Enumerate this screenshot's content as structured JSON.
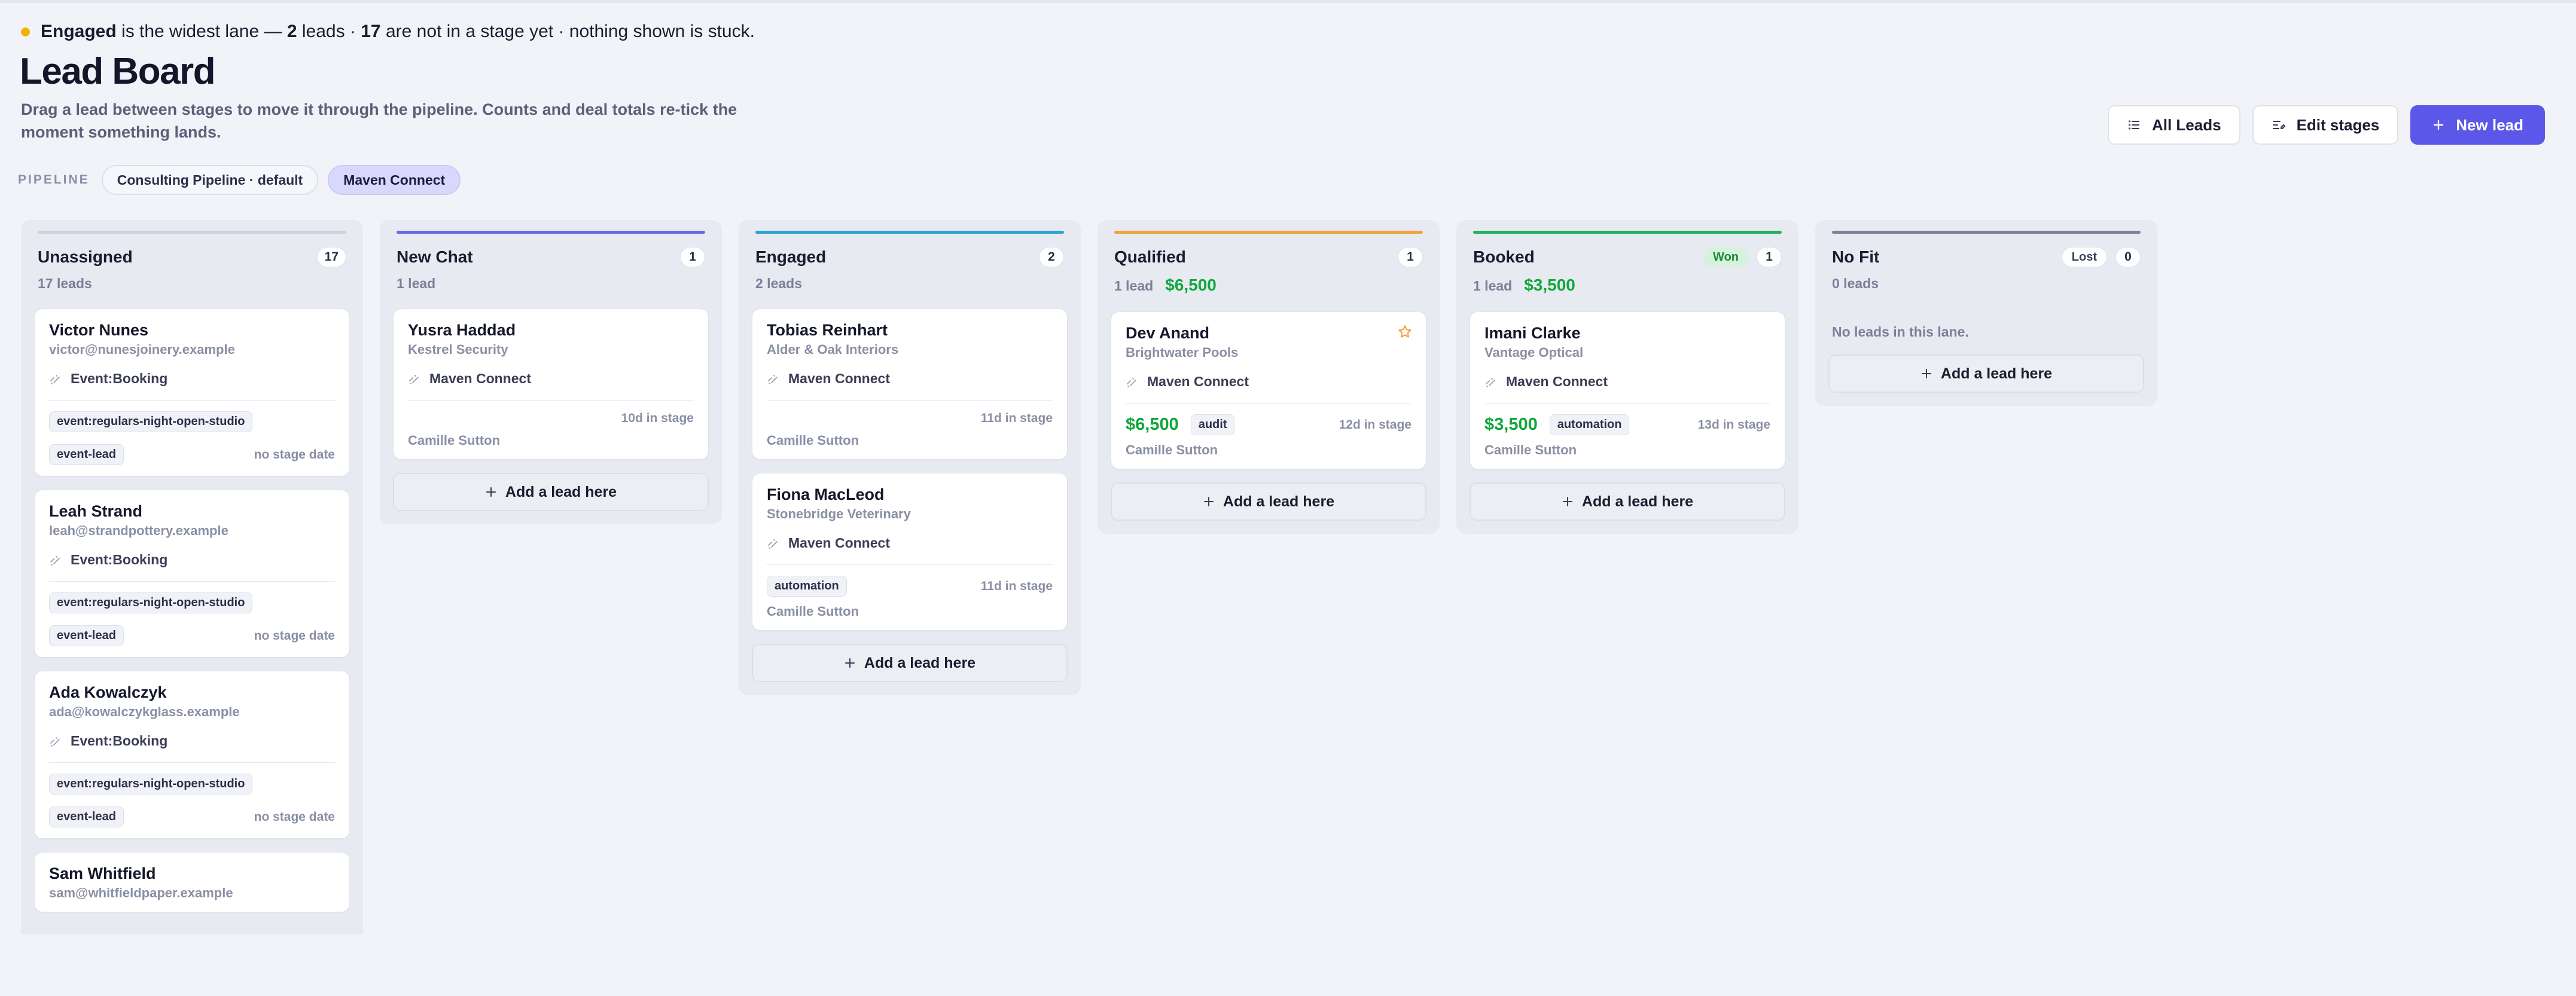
{
  "notice": {
    "lane": "Engaged",
    "text1": " is the widest lane — ",
    "count": "2",
    "text2": " leads · ",
    "unstaged": "17",
    "text3": " are not in a stage yet · nothing shown is stuck."
  },
  "header": {
    "title": "Lead Board",
    "subtitle": "Drag a lead between stages to move it through the pipeline. Counts and deal totals re-tick the moment something lands."
  },
  "pipeline": {
    "label": "PIPELINE",
    "options": [
      "Consulting Pipeline · default",
      "Maven Connect"
    ],
    "selected": "Maven Connect"
  },
  "actions": {
    "all_leads": "All Leads",
    "edit_stages": "Edit stages",
    "new_lead": "New lead"
  },
  "add_label": "Add a lead here",
  "colors": {
    "accent": "#5b57e8",
    "money": "#0fa83a",
    "unassigned": "#cfd2dc",
    "new_chat": "#6b68e6",
    "engaged": "#2aa3d8",
    "qualified": "#f2a33a",
    "booked": "#23b15a",
    "no_fit": "#7d8296"
  },
  "lanes": {
    "unassigned": {
      "name": "Unassigned",
      "count": "17",
      "sub": "17 leads",
      "cards": [
        {
          "name": "Victor Nunes",
          "sub": "victor@nunesjoinery.example",
          "source": "Event:Booking",
          "tag1": "event:regulars-night-open-studio",
          "tag2": "event-lead",
          "meta": "no stage date"
        },
        {
          "name": "Leah Strand",
          "sub": "leah@strandpottery.example",
          "source": "Event:Booking",
          "tag1": "event:regulars-night-open-studio",
          "tag2": "event-lead",
          "meta": "no stage date"
        },
        {
          "name": "Ada Kowalczyk",
          "sub": "ada@kowalczykglass.example",
          "source": "Event:Booking",
          "tag1": "event:regulars-night-open-studio",
          "tag2": "event-lead",
          "meta": "no stage date"
        },
        {
          "name": "Sam Whitfield",
          "sub": "sam@whitfieldpaper.example"
        }
      ]
    },
    "new_chat": {
      "name": "New Chat",
      "count": "1",
      "sub": "1 lead",
      "cards": [
        {
          "name": "Yusra Haddad",
          "sub": "Kestrel Security",
          "source": "Maven Connect",
          "meta": "10d in stage",
          "owner": "Camille Sutton"
        }
      ]
    },
    "engaged": {
      "name": "Engaged",
      "count": "2",
      "sub": "2 leads",
      "cards": [
        {
          "name": "Tobias Reinhart",
          "sub": "Alder & Oak Interiors",
          "source": "Maven Connect",
          "meta": "11d in stage",
          "owner": "Camille Sutton"
        },
        {
          "name": "Fiona MacLeod",
          "sub": "Stonebridge Veterinary",
          "source": "Maven Connect",
          "tag": "automation",
          "meta": "11d in stage",
          "owner": "Camille Sutton"
        }
      ]
    },
    "qualified": {
      "name": "Qualified",
      "count": "1",
      "sub": "1 lead",
      "sum": "$6,500",
      "cards": [
        {
          "name": "Dev Anand",
          "sub": "Brightwater Pools",
          "source": "Maven Connect",
          "amount": "$6,500",
          "tag": "audit",
          "meta": "12d in stage",
          "owner": "Camille Sutton",
          "starred": true
        }
      ]
    },
    "booked": {
      "name": "Booked",
      "badge": "Won",
      "count": "1",
      "sub": "1 lead",
      "sum": "$3,500",
      "cards": [
        {
          "name": "Imani Clarke",
          "sub": "Vantage Optical",
          "source": "Maven Connect",
          "amount": "$3,500",
          "tag": "automation",
          "meta": "13d in stage",
          "owner": "Camille Sutton"
        }
      ]
    },
    "no_fit": {
      "name": "No Fit",
      "badge": "Lost",
      "count": "0",
      "sub": "0 leads",
      "empty": "No leads in this lane."
    }
  }
}
